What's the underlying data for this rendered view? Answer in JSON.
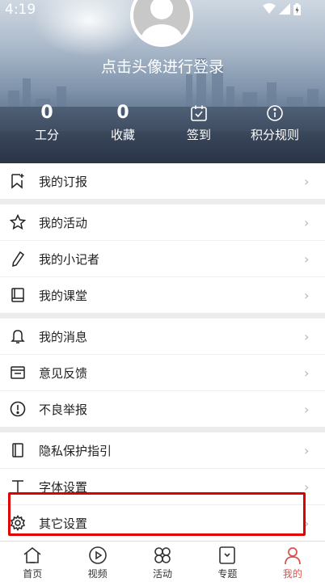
{
  "status": {
    "time": "4:19"
  },
  "profile": {
    "login_prompt": "点击头像进行登录"
  },
  "stats": [
    {
      "value": "0",
      "label": "工分"
    },
    {
      "value": "0",
      "label": "收藏"
    },
    {
      "label": "签到",
      "icon": "calendar-check-icon"
    },
    {
      "label": "积分规则",
      "icon": "info-icon"
    }
  ],
  "menu": {
    "subscription": "我的订报",
    "activities": "我的活动",
    "reporter": "我的小记者",
    "classroom": "我的课堂",
    "messages": "我的消息",
    "feedback": "意见反馈",
    "report": "不良举报",
    "privacy": "隐私保护指引",
    "font": "字体设置",
    "other": "其它设置"
  },
  "tabs": [
    {
      "label": "首页",
      "icon": "home-icon"
    },
    {
      "label": "视频",
      "icon": "play-icon"
    },
    {
      "label": "活动",
      "icon": "activity-icon"
    },
    {
      "label": "专题",
      "icon": "topic-icon"
    },
    {
      "label": "我的",
      "icon": "user-icon"
    }
  ],
  "colors": {
    "accent": "#d9534f",
    "highlight": "#e00000"
  }
}
